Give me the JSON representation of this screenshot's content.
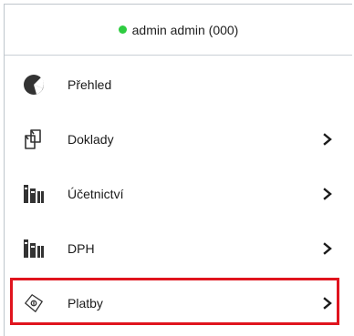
{
  "user": {
    "status_color": "#2ecc40",
    "label": "admin admin (000)"
  },
  "menu": {
    "items": [
      {
        "label": "Přehled",
        "icon": "pie-chart-icon",
        "has_submenu": false
      },
      {
        "label": "Doklady",
        "icon": "documents-icon",
        "has_submenu": true
      },
      {
        "label": "Účetnictví",
        "icon": "books-icon",
        "has_submenu": true
      },
      {
        "label": "DPH",
        "icon": "books-icon",
        "has_submenu": true
      },
      {
        "label": "Platby",
        "icon": "payment-icon",
        "has_submenu": true,
        "highlighted": true
      }
    ]
  },
  "colors": {
    "highlight_border": "#e0141e",
    "icon": "#333333"
  }
}
